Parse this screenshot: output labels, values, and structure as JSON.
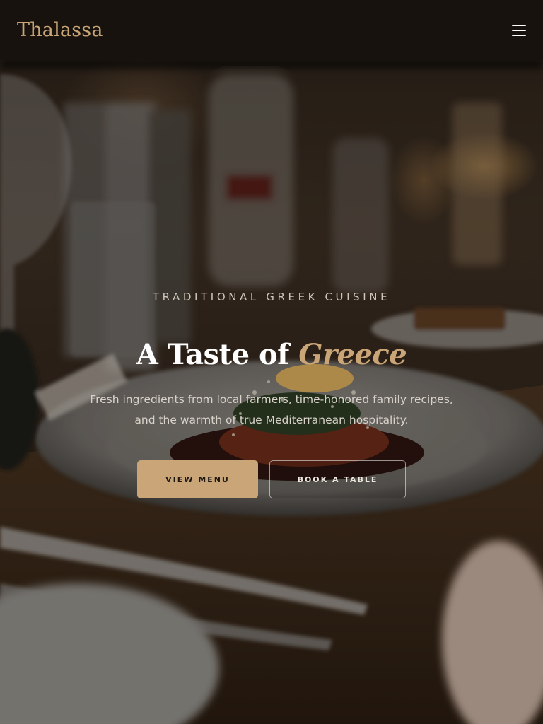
{
  "nav": {
    "brand": "Thalassa",
    "menu_icon": "hamburger-menu-icon"
  },
  "hero": {
    "eyebrow": "TRADITIONAL GREEK CUISINE",
    "headline_main": "A Taste of ",
    "headline_accent": "Greece",
    "subtext": "Fresh ingredients from local farmers, time-honored family recipes, and the warmth of true Mediterranean hospitality.",
    "primary_cta": "VIEW MENU",
    "secondary_cta": "BOOK A TABLE",
    "background_image": "restaurant-table-plated-dish-photo"
  },
  "colors": {
    "accent": "#c9a578",
    "nav_background": "#17120e",
    "primary_button_text": "#1e1812"
  }
}
